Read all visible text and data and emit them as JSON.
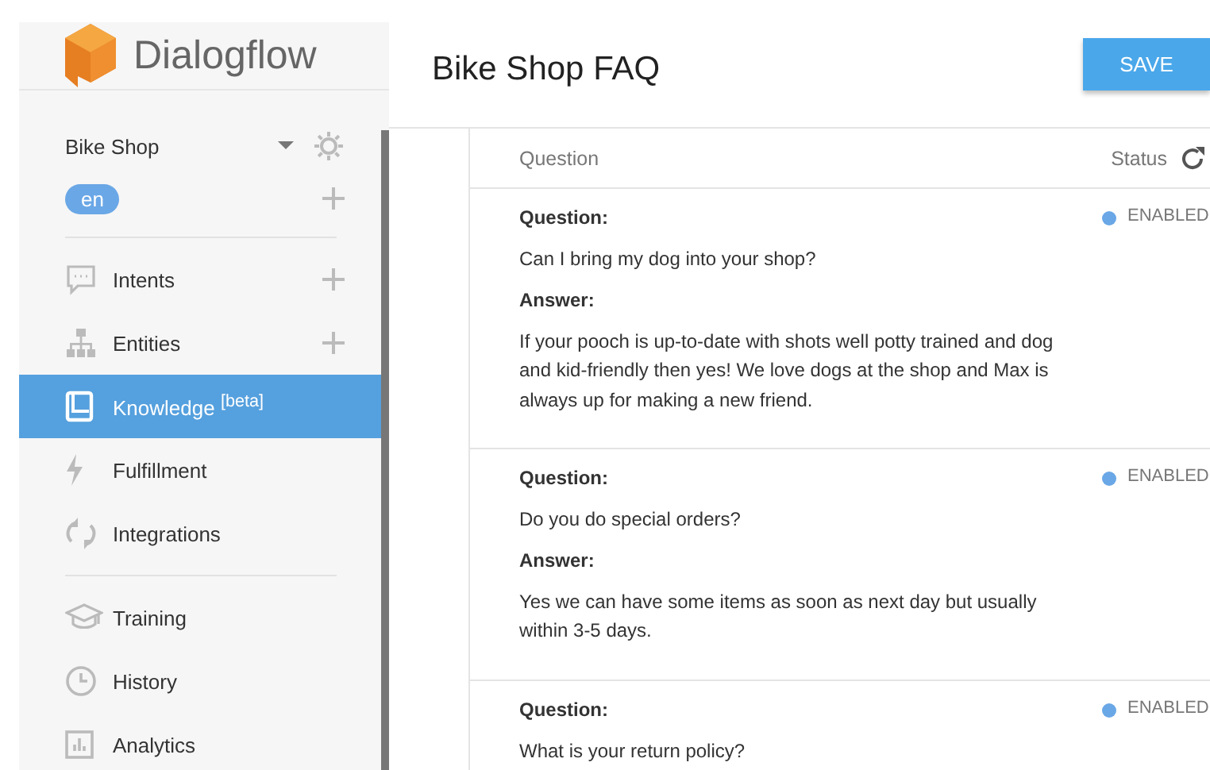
{
  "brand": {
    "name": "Dialogflow"
  },
  "sidebar": {
    "agent": "Bike Shop",
    "language": "en",
    "items": [
      {
        "kind": "nav",
        "label": "Intents",
        "add": true,
        "selected": false
      },
      {
        "kind": "nav",
        "label": "Entities",
        "add": true,
        "selected": false
      },
      {
        "kind": "nav",
        "label": "Knowledge $^{[beta]}$",
        "add": false,
        "selected": true
      },
      {
        "kind": "nav",
        "label": "Fulfillment",
        "add": false,
        "selected": false
      },
      {
        "kind": "nav",
        "label": "Integrations",
        "add": false,
        "selected": false
      },
      {
        "kind": "divider"
      },
      {
        "kind": "nav",
        "label": "Training",
        "add": false,
        "selected": false
      },
      {
        "kind": "nav",
        "label": "History",
        "add": false,
        "selected": false
      },
      {
        "kind": "nav",
        "label": "Analytics",
        "add": false,
        "selected": false
      }
    ]
  },
  "header": {
    "title": "Bike Shop FAQ",
    "save": "SAVE"
  },
  "table": {
    "columns": [
      "Question",
      "Status"
    ],
    "rows": [
      {
        "question_label": "Question:",
        "question": "Can I bring my dog into your shop?",
        "answer_label": "Answer:",
        "answer": "If your pooch is up-to-date with shots well potty trained and dog and kid-friendly then yes! We love dogs at the shop and Max is always up for making a new friend.",
        "status": "ENABLED",
        "enabled": true
      },
      {
        "question_label": "Question:",
        "question": "Do you do special orders?",
        "answer_label": "Answer:",
        "answer": "Yes we can have some items as soon as next day but usually within 3-5 days.",
        "status": "ENABLED",
        "enabled": true
      },
      {
        "question_label": "Question:",
        "question": "What is your return policy?",
        "status": "ENABLED",
        "enabled": true
      }
    ]
  }
}
